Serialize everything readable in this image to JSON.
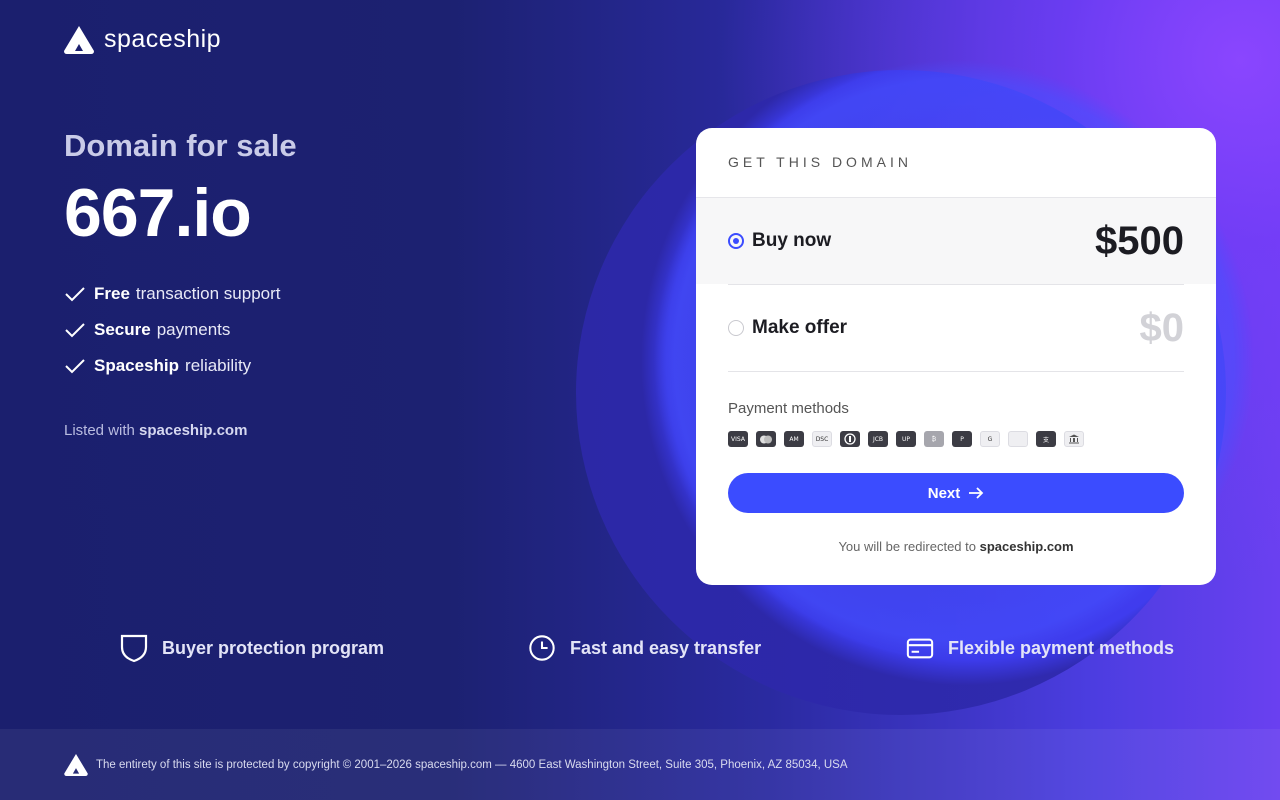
{
  "brand": {
    "name": "spaceship"
  },
  "hero": {
    "subtitle": "Domain for sale",
    "domain": "667.io",
    "features": [
      {
        "bold": "Free",
        "rest": "transaction support"
      },
      {
        "bold": "Secure",
        "rest": "payments"
      },
      {
        "bold": "Spaceship",
        "rest": "reliability"
      }
    ],
    "listed_prefix": "Listed with",
    "listed_site": "spaceship.com"
  },
  "card": {
    "heading": "GET THIS DOMAIN",
    "options": [
      {
        "label": "Buy now",
        "price": "$500",
        "selected": true
      },
      {
        "label": "Make offer",
        "price": "$0",
        "selected": false
      }
    ],
    "payment_title": "Payment methods",
    "payment_icons": [
      "visa-icon",
      "mastercard-icon",
      "amex-icon",
      "discover-icon",
      "diners-icon",
      "jcb-icon",
      "unionpay-icon",
      "bitcoin-icon",
      "paypal-icon",
      "google-pay-icon",
      "apple-pay-icon",
      "alipay-icon",
      "bank-icon"
    ],
    "next_label": "Next",
    "redirect_prefix": "You will be redirected to",
    "redirect_site": "spaceship.com"
  },
  "benefits": [
    {
      "icon": "shield-icon",
      "label": "Buyer protection program"
    },
    {
      "icon": "clock-icon",
      "label": "Fast and easy transfer"
    },
    {
      "icon": "credit-card-icon",
      "label": "Flexible payment methods"
    }
  ],
  "footer": {
    "text": "The entirety of this site is protected by copyright © 2001–2026 spaceship.com — 4600 East Washington Street, Suite 305, Phoenix, AZ 85034, USA"
  },
  "colors": {
    "accent": "#3b4cff",
    "background": "#1a1f6b",
    "highlight": "#7b3ff5"
  }
}
